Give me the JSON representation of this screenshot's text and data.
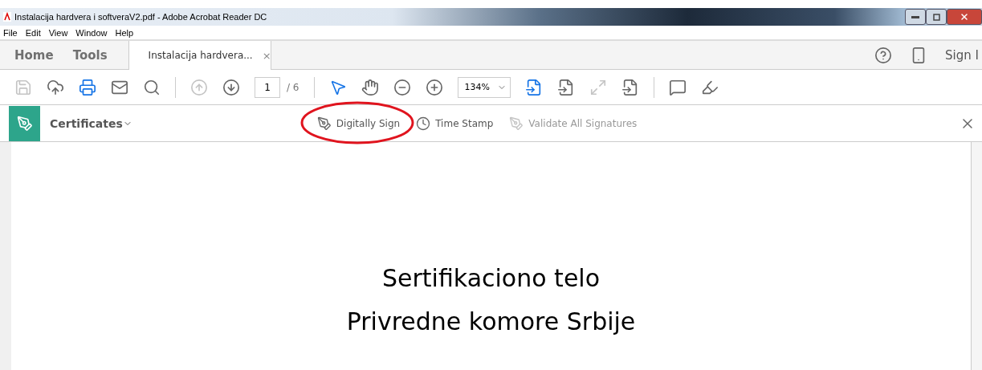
{
  "window": {
    "title": "Instalacija hardvera i softveraV2.pdf - Adobe Acrobat Reader DC"
  },
  "menu": [
    "File",
    "Edit",
    "View",
    "Window",
    "Help"
  ],
  "tabs": [
    {
      "label": "Home",
      "selected": false,
      "kind": "nav"
    },
    {
      "label": "Tools",
      "selected": false,
      "kind": "nav"
    },
    {
      "label": "Instalacija hardvera...",
      "selected": true,
      "kind": "document",
      "close": "×"
    }
  ],
  "account": {
    "sign_in": "Sign I"
  },
  "toolbar": {
    "left": [
      {
        "disabled": true
      },
      {
        "disabled": false
      },
      {
        "disabled": false
      },
      {
        "disabled": false
      },
      {
        "disabled": false
      }
    ],
    "nav": [
      {
        "disabled": true
      },
      {
        "disabled": false
      }
    ],
    "page": {
      "value": "1",
      "total": "/ 6"
    },
    "tools": [
      {
        "selected": true
      },
      {
        "selected": false
      },
      {
        "selected": false
      },
      {
        "selected": false
      }
    ],
    "zoom": "134%",
    "view": [
      {
        "disabled": false
      },
      {
        "disabled": false
      },
      {
        "disabled": true
      },
      {
        "disabled": false
      }
    ],
    "annotate": [
      {
        "disabled": false
      },
      {
        "disabled": false
      }
    ]
  },
  "certificates_bar": {
    "title": "Certificates",
    "actions": [
      {
        "label": "Digitally Sign",
        "disabled": false,
        "highlighted": true
      },
      {
        "label": "Time Stamp",
        "disabled": false,
        "highlighted": false
      },
      {
        "label": "Validate All Signatures",
        "disabled": true,
        "highlighted": false
      }
    ]
  },
  "document": {
    "lines": [
      "Sertifikaciono telo",
      "Privredne komore Srbije"
    ]
  }
}
